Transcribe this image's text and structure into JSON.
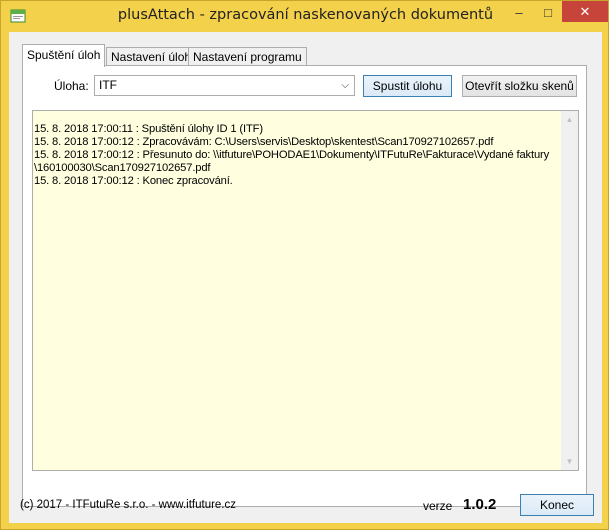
{
  "window": {
    "title": "plusAttach - zpracování naskenovaných dokumentů",
    "minimize_glyph": "–",
    "maximize_glyph": "□",
    "close_glyph": "✕"
  },
  "tabs": [
    {
      "label": "Spuštění úloh"
    },
    {
      "label": "Nastavení úloh"
    },
    {
      "label": "Nastavení programu"
    }
  ],
  "task": {
    "label": "Úloha:",
    "selected": "ITF",
    "run_button": "Spustit úlohu",
    "open_folder_button": "Otevřít složku skenů"
  },
  "log": {
    "lines": [
      "15. 8. 2018 17:00:11 : Spuštění úlohy ID 1 (ITF)",
      "15. 8. 2018 17:00:12 : Zpracovávám: C:\\Users\\servis\\Desktop\\skentest\\Scan170927102657.pdf",
      "15. 8. 2018 17:00:12 : Přesunuto do: \\\\itfuture\\POHODAE1\\Dokumenty\\ITFutuRe\\Fakturace\\Vydané faktury",
      "\\160100030\\Scan170927102657.pdf",
      "15. 8. 2018 17:00:12 : Konec zpracování."
    ]
  },
  "footer": {
    "copyright": "(c) 2017 - ITFutuRe s.r.o.  - www.itfuture.cz",
    "version_label": "verze",
    "version": "1.0.2",
    "close_button": "Konec"
  },
  "colors": {
    "title_bar": "#f3d14a",
    "close_button": "#c7443a",
    "log_background": "#ffffe0"
  }
}
